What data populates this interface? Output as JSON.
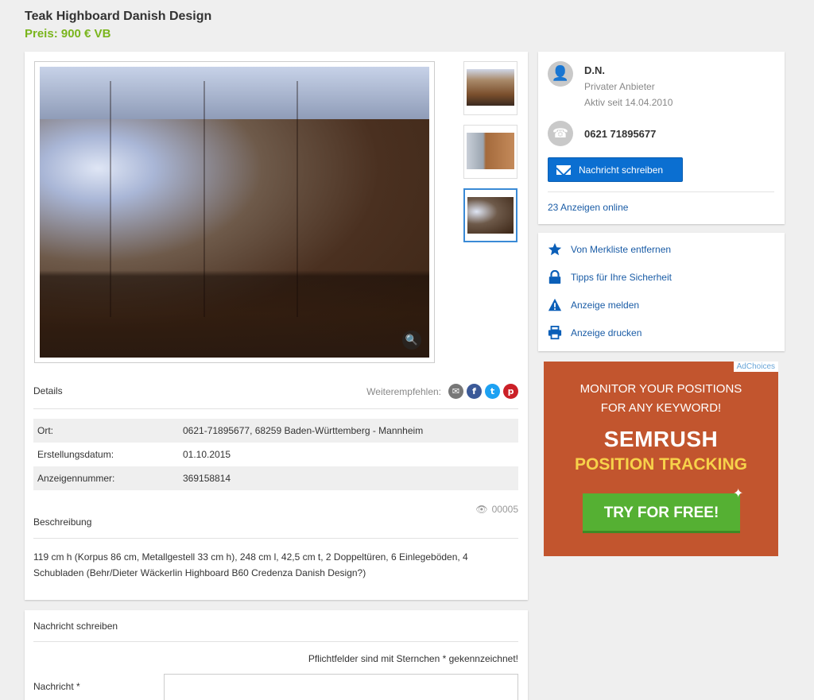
{
  "listing": {
    "title": "Teak Highboard Danish Design",
    "price": "Preis: 900 € VB"
  },
  "gallery": {
    "thumbnails": [
      "thumbnail-1",
      "thumbnail-2",
      "thumbnail-3"
    ],
    "active_index": 2
  },
  "details": {
    "heading": "Details",
    "share_label": "Weiterempfehlen:",
    "rows": [
      {
        "key": "Ort:",
        "value": "0621-71895677, 68259 Baden-Württemberg - Mannheim"
      },
      {
        "key": "Erstellungsdatum:",
        "value": "01.10.2015"
      },
      {
        "key": "Anzeigennummer:",
        "value": "369158814"
      }
    ],
    "views": "00005",
    "description_heading": "Beschreibung",
    "description": "119 cm h (Korpus 86 cm, Metallgestell 33 cm h), 248 cm l, 42,5 cm t, 2 Doppeltüren, 6 Einlegeböden, 4 Schubladen (Behr/Dieter Wäckerlin Highboard B60 Credenza Danish Design?)"
  },
  "message_form": {
    "heading": "Nachricht schreiben",
    "required_note": "Pflichtfelder sind mit Sternchen * gekennzeichnet!",
    "message_label": "Nachricht *",
    "message_value": ""
  },
  "seller": {
    "name": "D.N.",
    "type": "Privater Anbieter",
    "since": "Aktiv seit 14.04.2010",
    "phone": "0621 71895677",
    "contact_button": "Nachricht schreiben",
    "ads_online": "23 Anzeigen online"
  },
  "actions": [
    {
      "label": "Von Merkliste entfernen",
      "icon": "star-icon"
    },
    {
      "label": "Tipps für Ihre Sicherheit",
      "icon": "lock-icon"
    },
    {
      "label": "Anzeige melden",
      "icon": "warning-icon"
    },
    {
      "label": "Anzeige drucken",
      "icon": "printer-icon"
    }
  ],
  "ad": {
    "adchoices": "AdChoices",
    "line1": "MONITOR YOUR POSITIONS",
    "line2": "FOR ANY KEYWORD!",
    "brand": "SEMRUSH",
    "subtitle": "POSITION TRACKING",
    "cta": "TRY FOR FREE!",
    "bg_color": "#c2552e",
    "cta_color": "#55b033",
    "subtitle_color": "#f7d24a"
  },
  "colors": {
    "price": "#7ab51d",
    "primary_button": "#0b6fd1",
    "link": "#1a5ca6"
  }
}
